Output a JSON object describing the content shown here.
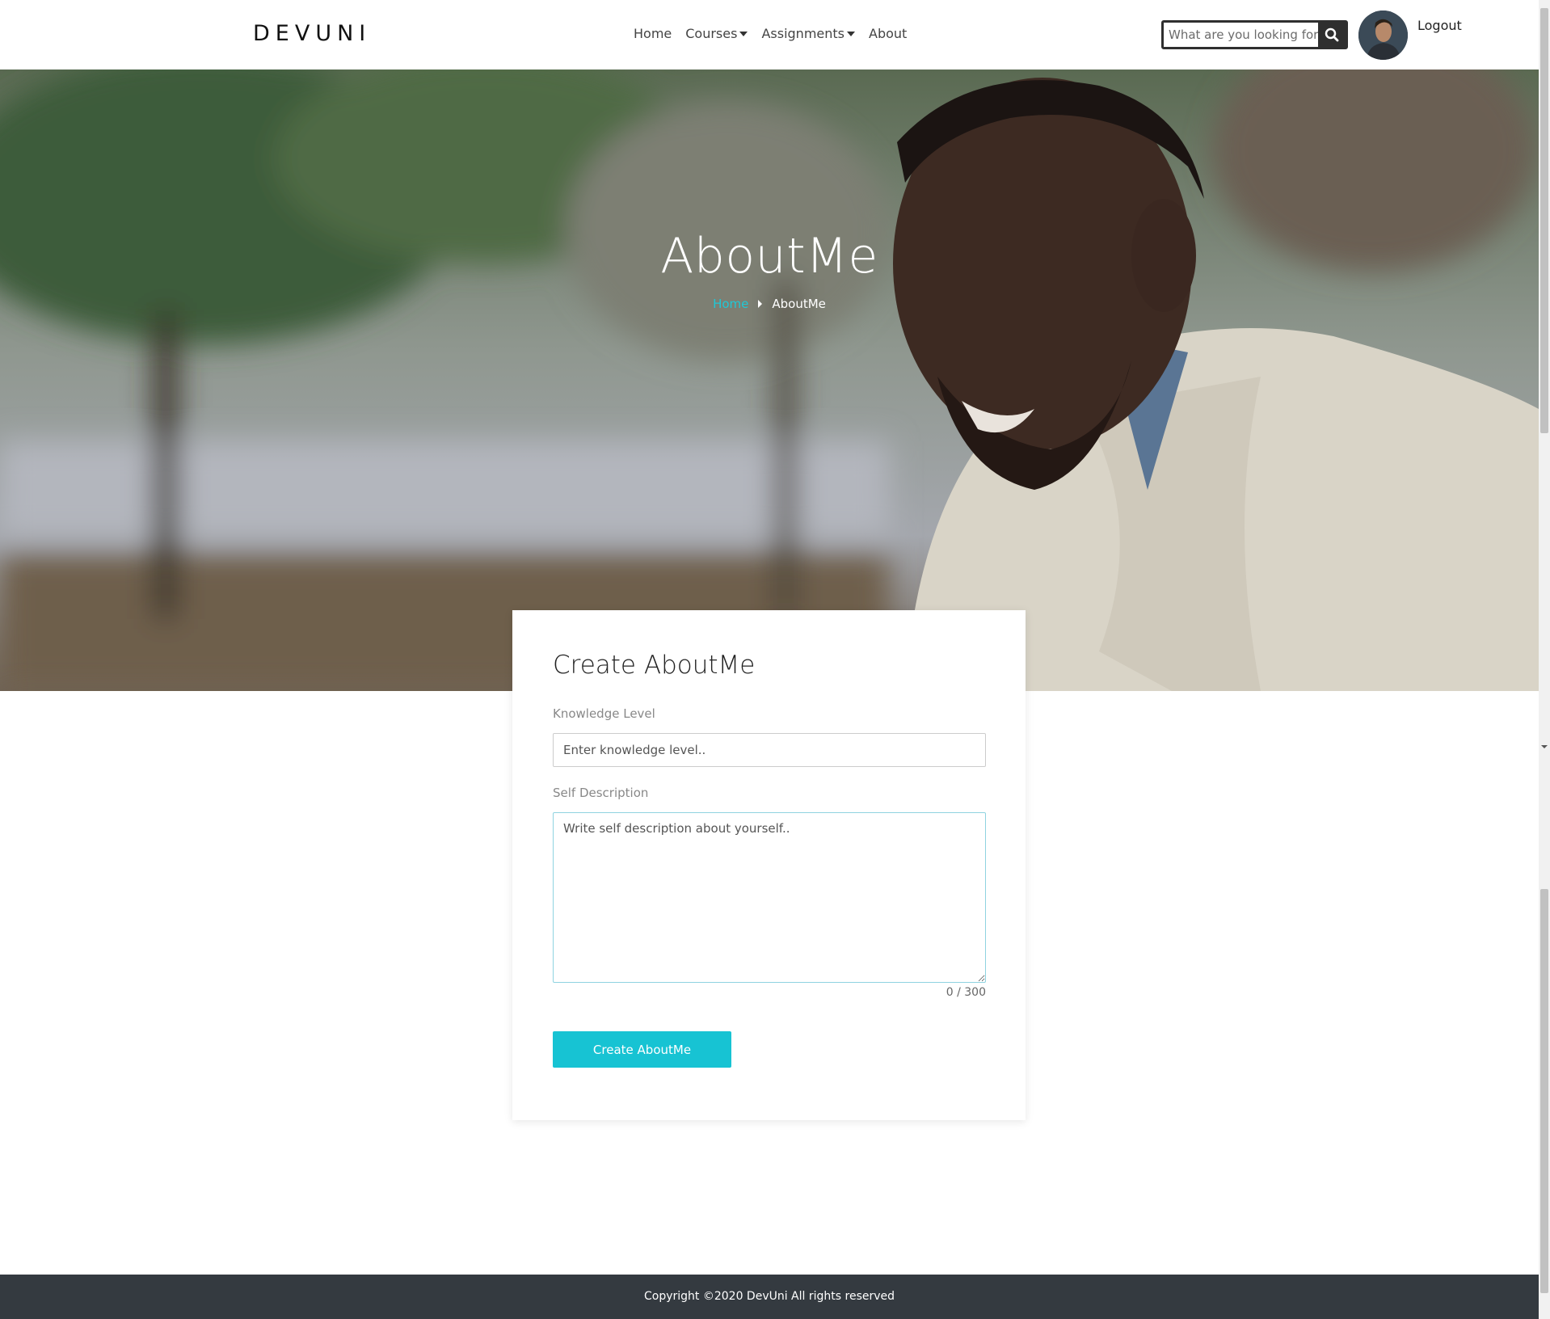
{
  "header": {
    "logo": "DEVUNI",
    "nav": [
      {
        "label": "Home",
        "has_dropdown": false
      },
      {
        "label": "Courses",
        "has_dropdown": true
      },
      {
        "label": "Assignments",
        "has_dropdown": true
      },
      {
        "label": "About",
        "has_dropdown": false
      }
    ],
    "search_placeholder": "What are you looking for",
    "search_icon": "search-icon",
    "logout_label": "Logout"
  },
  "hero": {
    "title": "AboutMe",
    "breadcrumb": {
      "home": "Home",
      "current": "AboutMe"
    }
  },
  "form": {
    "title": "Create AboutMe",
    "knowledge_label": "Knowledge Level",
    "knowledge_placeholder": "Enter knowledge level..",
    "self_label": "Self Description",
    "self_placeholder": "Write self description about yourself..",
    "char_count": "0 / 300",
    "submit_label": "Create AboutMe"
  },
  "footer": {
    "copyright": "Copyright ©2020 DevUni All rights reserved"
  },
  "colors": {
    "accent": "#17c3d3",
    "footer_bg": "#343a40",
    "search_border": "#2f2f2f"
  }
}
